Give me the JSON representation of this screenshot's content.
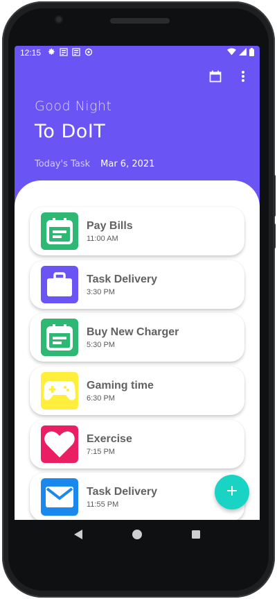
{
  "status_bar": {
    "time": "12:15"
  },
  "header": {
    "greeting": "Good Night",
    "app_title": "To DoIT",
    "subtitle_label": "Today's Task",
    "date": "Mar 6, 2021"
  },
  "tasks": [
    {
      "name": "Pay Bills",
      "time": "11:00 AM",
      "icon": "calendar-note-icon",
      "color": "#2fb774"
    },
    {
      "name": "Task Delivery",
      "time": "3:30 PM",
      "icon": "briefcase-icon",
      "color": "#6a55f4"
    },
    {
      "name": "Buy New Charger",
      "time": "5:30 PM",
      "icon": "calendar-note-icon",
      "color": "#2fb774"
    },
    {
      "name": "Gaming time",
      "time": "6:30 PM",
      "icon": "gamepad-icon",
      "color": "#ffee3b"
    },
    {
      "name": "Exercise",
      "time": "7:15 PM",
      "icon": "heart-icon",
      "color": "#ea1e63"
    },
    {
      "name": "Task Delivery",
      "time": "11:55 PM",
      "icon": "mail-icon",
      "color": "#1b88ee"
    }
  ],
  "colors": {
    "primary": "#6a55f4",
    "fab": "#19d3c5"
  }
}
